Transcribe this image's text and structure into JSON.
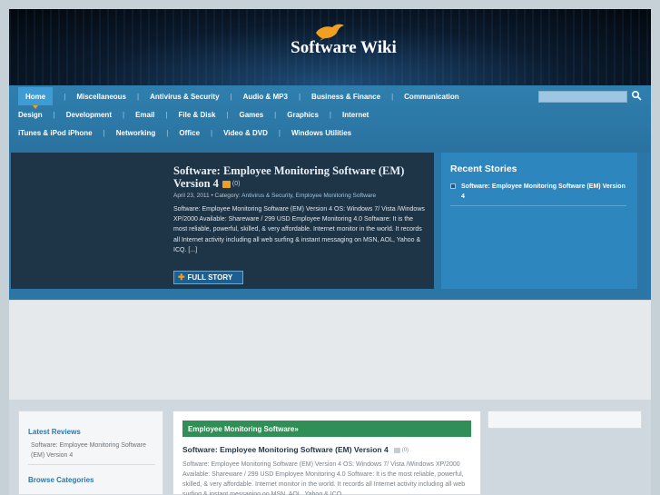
{
  "site": {
    "title": "Software Wiki"
  },
  "nav": {
    "row1": [
      "Home",
      "Miscellaneous",
      "Antivirus & Security",
      "Audio & MP3",
      "Business & Finance",
      "Communication"
    ],
    "row2": [
      "Design",
      "Development",
      "Email",
      "File & Disk",
      "Games",
      "Graphics",
      "Internet"
    ],
    "row3": [
      "iTunes & iPod iPhone",
      "Networking",
      "Office",
      "Video & DVD",
      "Windows Utilities"
    ],
    "active": "Home",
    "search_placeholder": ""
  },
  "featured": {
    "title": "Software: Employee Monitoring Software (EM) Version 4",
    "comments": "(0)",
    "date": "April 23, 2011",
    "category_label": "• Category:",
    "categories": "Antivirus & Security, Employee Monitoring Software",
    "excerpt": "Software: Employee Monitoring Software (EM) Version 4 OS: Windows 7/ Vista /Windows XP/2000 Available: Shareware / 299 USD Employee Monitoring 4.0 Software: It is the most reliable, powerful, skilled, & very affordable. Internet monitor in the world. It records all Internet activity including all web surfing & instant messaging on MSN, AOL, Yahoo & ICQ. [...]",
    "button_label": "FULL STORY"
  },
  "recent": {
    "heading": "Recent Stories",
    "items": [
      "Software: Employee Monitoring Software (EM) Version 4"
    ]
  },
  "sidebar": {
    "latest_heading": "Latest Reviews",
    "latest_link": "Software: Employee Monitoring Software (EM) Version 4",
    "browse_heading": "Browse Categories"
  },
  "main": {
    "category_bar": "Employee Monitoring Software»",
    "post_title": "Software: Employee Monitoring Software (EM) Version 4",
    "post_comments": "(0)",
    "post_excerpt": "Software: Employee Monitoring Software (EM) Version 4 OS: Windows 7/ Vista /Windows XP/2000 Available: Shareware / 299 USD Employee Monitoring 4.0 Software: It is the most reliable, powerful, skilled, & very affordable. Internet monitor in the world. It records all Internet activity including all web surfing & instant messaging on MSN, AOL, Yahoo & ICQ."
  },
  "colors": {
    "nav": "#2f7fae",
    "accent": "#f0a020",
    "green_bar": "#2f8f56"
  }
}
